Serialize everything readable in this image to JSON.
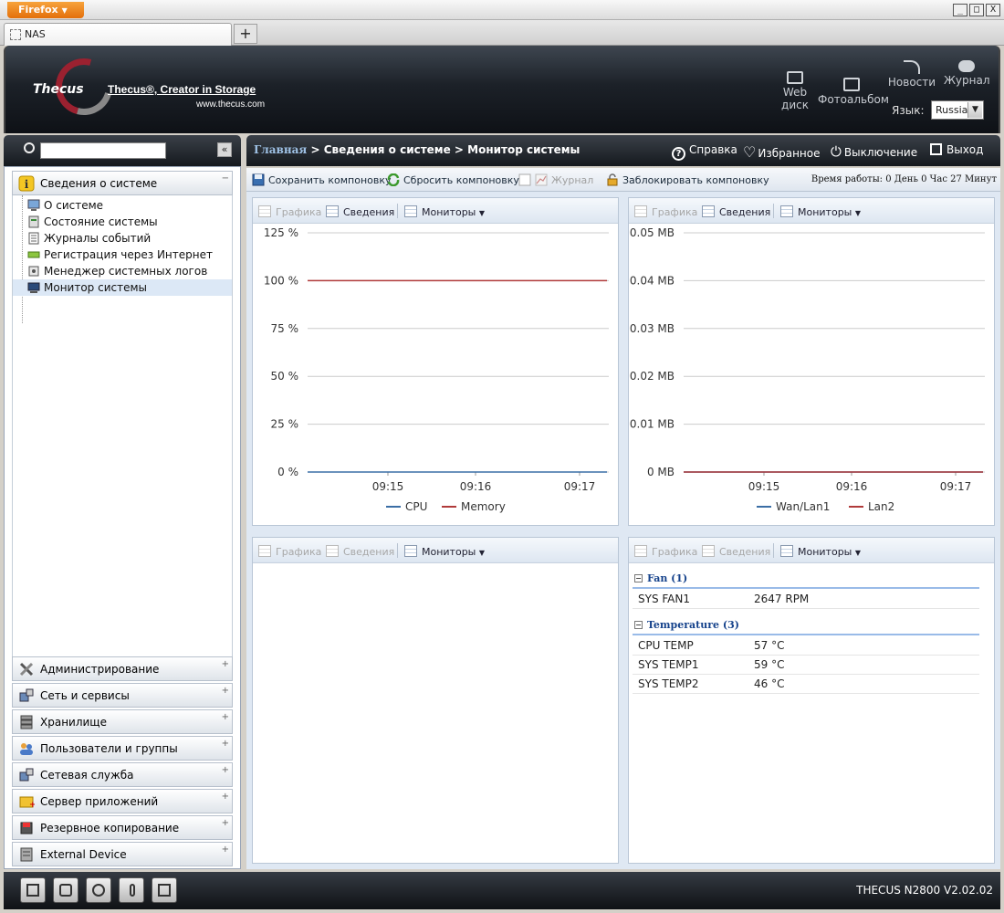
{
  "browser": {
    "app_button": "Firefox",
    "tab_title": "NAS",
    "new_tab": "+",
    "controls": [
      "_",
      "□",
      "X"
    ]
  },
  "header": {
    "brand": "Thecus",
    "tagline": "Thecus®, Creator in Storage",
    "url": "www.thecus.com",
    "webdisk_line1": "Web",
    "webdisk_line2": "диск",
    "photo": "Фотоальбом",
    "news": "Новости",
    "journal": "Журнал",
    "lang_label": "Язык:",
    "lang_value": "Russia"
  },
  "sidebar": {
    "search_placeholder": "",
    "collapse": "«",
    "open_section": "Сведения о системе",
    "items": [
      {
        "label": "О системе",
        "icon": "monitor-icon"
      },
      {
        "label": "Состояние системы",
        "icon": "status-icon"
      },
      {
        "label": "Журналы событий",
        "icon": "log-icon"
      },
      {
        "label": "Регистрация через Интернет",
        "icon": "register-icon"
      },
      {
        "label": "Менеджер системных логов",
        "icon": "syslog-icon"
      },
      {
        "label": "Монитор системы",
        "icon": "system-monitor-icon"
      }
    ],
    "sections": [
      "Администрирование",
      "Сеть и сервисы",
      "Хранилище",
      "Пользователи и группы",
      "Сетевая служба",
      "Сервер приложений",
      "Резервное копирование",
      "External Device"
    ]
  },
  "topbar": {
    "crumb_home": "Главная",
    "crumb_rest": " > Сведения о системе > Монитор системы",
    "help": "Справка",
    "favorites": "Избранное",
    "shutdown": "Выключение",
    "logout": "Выход"
  },
  "toolbar": {
    "save_layout": "Сохранить компоновку",
    "reset_layout": "Сбросить компоновку",
    "journal": "Журнал",
    "lock_layout": "Заблокировать компоновку",
    "uptime": "Время работы:  0 День 0 Час 27 Минут"
  },
  "monitor": {
    "graph": "Графика",
    "details": "Сведения",
    "monitors": "Мониторы"
  },
  "chart_data": [
    {
      "type": "line",
      "x": [
        "09:15",
        "09:16",
        "09:17"
      ],
      "yticks": [
        "125 %",
        "100 %",
        "75 %",
        "50 %",
        "25 %",
        "0 %"
      ],
      "ylim": [
        0,
        125
      ],
      "series": [
        {
          "name": "CPU",
          "color": "#3a6ea5",
          "values": [
            0,
            0,
            0
          ]
        },
        {
          "name": "Memory",
          "color": "#b03a3a",
          "values": [
            100,
            100,
            100
          ]
        }
      ]
    },
    {
      "type": "line",
      "x": [
        "09:15",
        "09:16",
        "09:17"
      ],
      "yticks": [
        "0.05 MB",
        "0.04 MB",
        "0.03 MB",
        "0.02 MB",
        "0.01 MB",
        "0 MB"
      ],
      "ylim": [
        0,
        0.05
      ],
      "series": [
        {
          "name": "Wan/Lan1",
          "color": "#3a6ea5",
          "values": [
            0,
            0,
            0
          ]
        },
        {
          "name": "Lan2",
          "color": "#b03a3a",
          "values": [
            0,
            0,
            0
          ]
        }
      ]
    }
  ],
  "sensors": {
    "fan_group": "Fan (1)",
    "fans": [
      {
        "name": "SYS FAN1",
        "value": "2647 RPM"
      }
    ],
    "temp_group": "Temperature (3)",
    "temps": [
      {
        "name": "CPU TEMP",
        "value": "57 °C"
      },
      {
        "name": "SYS TEMP1",
        "value": "59 °C"
      },
      {
        "name": "SYS TEMP2",
        "value": "46 °C"
      }
    ]
  },
  "footer": {
    "model": "THECUS N2800 V2.02.02"
  }
}
